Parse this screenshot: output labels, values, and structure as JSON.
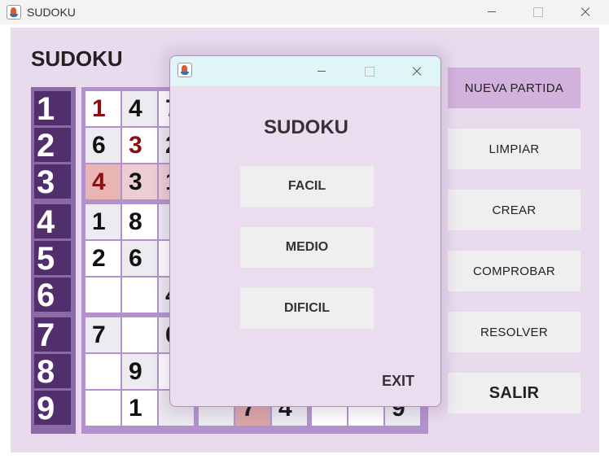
{
  "window": {
    "title": "SUDOKU"
  },
  "main": {
    "heading": "SUDOKU"
  },
  "row_numbers": [
    "1",
    "2",
    "3",
    "4",
    "5",
    "6",
    "7",
    "8",
    "9"
  ],
  "board": {
    "cells": [
      {
        "row": 1,
        "col": 1,
        "text": "1",
        "color": "#8b1111",
        "bg": "#ffffff"
      },
      {
        "row": 1,
        "col": 2,
        "text": "4",
        "bg": "#ebebf0"
      },
      {
        "row": 1,
        "col": 3,
        "text": "7",
        "bg": "#ffffff"
      },
      {
        "row": 2,
        "col": 1,
        "text": "6",
        "bg": "#ebebf0"
      },
      {
        "row": 2,
        "col": 2,
        "text": "3",
        "color": "#8b1111",
        "bg": "#ffffff"
      },
      {
        "row": 2,
        "col": 3,
        "text": "2",
        "bg": "#ebebf0"
      },
      {
        "row": 3,
        "col": 1,
        "text": "4",
        "color": "#8b1111",
        "bg": "#e8b4b4"
      },
      {
        "row": 3,
        "col": 2,
        "text": "3",
        "bg": "#eecdd2"
      },
      {
        "row": 3,
        "col": 3,
        "text": "1",
        "bg": "#eecdd2"
      },
      {
        "row": 4,
        "col": 1,
        "text": "1",
        "bg": "#ebebf0"
      },
      {
        "row": 4,
        "col": 2,
        "text": "8",
        "bg": "#ffffff"
      },
      {
        "row": 4,
        "col": 3,
        "text": "",
        "bg": "#ebebf0"
      },
      {
        "row": 5,
        "col": 1,
        "text": "2",
        "bg": "#ffffff"
      },
      {
        "row": 5,
        "col": 2,
        "text": "6",
        "bg": "#ebebf0"
      },
      {
        "row": 5,
        "col": 3,
        "text": "",
        "bg": "#ffffff"
      },
      {
        "row": 6,
        "col": 1,
        "text": "",
        "bg": "#ffffff"
      },
      {
        "row": 6,
        "col": 2,
        "text": "",
        "bg": "#ffffff"
      },
      {
        "row": 6,
        "col": 3,
        "text": "4",
        "bg": "#ebebf0"
      },
      {
        "row": 7,
        "col": 1,
        "text": "7",
        "bg": "#ebebf0"
      },
      {
        "row": 7,
        "col": 2,
        "text": "",
        "bg": "#ffffff"
      },
      {
        "row": 7,
        "col": 3,
        "text": "6",
        "bg": "#ebebf0"
      },
      {
        "row": 8,
        "col": 1,
        "text": "",
        "bg": "#ffffff"
      },
      {
        "row": 8,
        "col": 2,
        "text": "9",
        "bg": "#ebebf0"
      },
      {
        "row": 8,
        "col": 3,
        "text": "",
        "bg": "#ffffff"
      },
      {
        "row": 9,
        "col": 1,
        "text": "",
        "bg": "#ffffff"
      },
      {
        "row": 9,
        "col": 2,
        "text": "1",
        "bg": "#ffffff"
      },
      {
        "row": 9,
        "col": 3,
        "text": "",
        "bg": "#ebebf0"
      },
      {
        "row": 9,
        "col": 4,
        "text": "",
        "bg": "#ebebf0"
      },
      {
        "row": 9,
        "col": 5,
        "text": "7",
        "bg": "#d9a6a6"
      },
      {
        "row": 9,
        "col": 6,
        "text": "4",
        "bg": "#ebebf0"
      },
      {
        "row": 9,
        "col": 7,
        "text": "",
        "bg": "#ffffff"
      },
      {
        "row": 9,
        "col": 8,
        "text": "",
        "bg": "#ffffff"
      },
      {
        "row": 9,
        "col": 9,
        "text": "9",
        "bg": "#ebebf0"
      }
    ]
  },
  "side_buttons": [
    {
      "label": "NUEVA  PARTIDA",
      "active": true
    },
    {
      "label": "LIMPIAR"
    },
    {
      "label": "CREAR"
    },
    {
      "label": "COMPROBAR"
    },
    {
      "label": "RESOLVER"
    },
    {
      "label": "SALIR",
      "bold": true
    }
  ],
  "dialog": {
    "heading": "SUDOKU",
    "levels": [
      "FACIL",
      "MEDIO",
      "DIFICIL"
    ],
    "exit_label": "EXIT"
  },
  "colors": {
    "panel_bg": "#e9dbee",
    "row_number_bg": "#512e6c",
    "board_border": "#b292cc",
    "active_button": "#d2b2dc",
    "error_digit": "#8b1111",
    "dialog_titlebar": "#e0f5f5"
  },
  "icons": [
    "java-app-icon",
    "minimize-icon",
    "maximize-icon",
    "close-icon"
  ]
}
